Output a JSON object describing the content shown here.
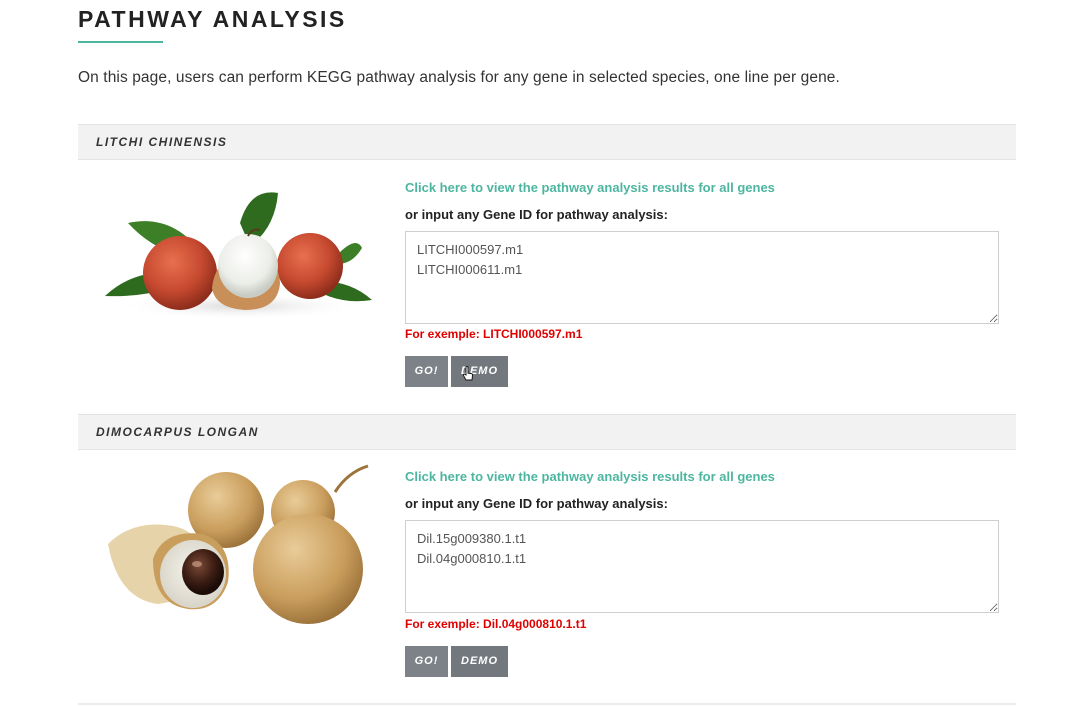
{
  "page": {
    "title": "PATHWAY ANALYSIS",
    "intro": "On this page, users can perform KEGG pathway analysis for any gene in selected species, one line per gene."
  },
  "species": [
    {
      "name": "LITCHI CHINENSIS",
      "image": "litchi-fruit-image",
      "view_link": "Click here to view the pathway analysis results for all genes",
      "input_label": "or input any Gene ID for pathway analysis:",
      "genes_value": "LITCHI000597.m1\nLITCHI000611.m1",
      "example": "For exemple: LITCHI000597.m1",
      "go_label": "GO!",
      "demo_label": "DEMO"
    },
    {
      "name": "DIMOCARPUS LONGAN",
      "image": "longan-fruit-image",
      "view_link": "Click here to view the pathway analysis results for all genes",
      "input_label": "or input any Gene ID for pathway analysis:",
      "genes_value": "Dil.15g009380.1.t1\nDil.04g000810.1.t1",
      "example": "For exemple: Dil.04g000810.1.t1",
      "go_label": "GO!",
      "demo_label": "DEMO"
    }
  ],
  "colors": {
    "accent": "#4db6a0",
    "example_red": "#e00000",
    "button_gray": "#7c8287",
    "header_bg": "#f2f2f2"
  }
}
